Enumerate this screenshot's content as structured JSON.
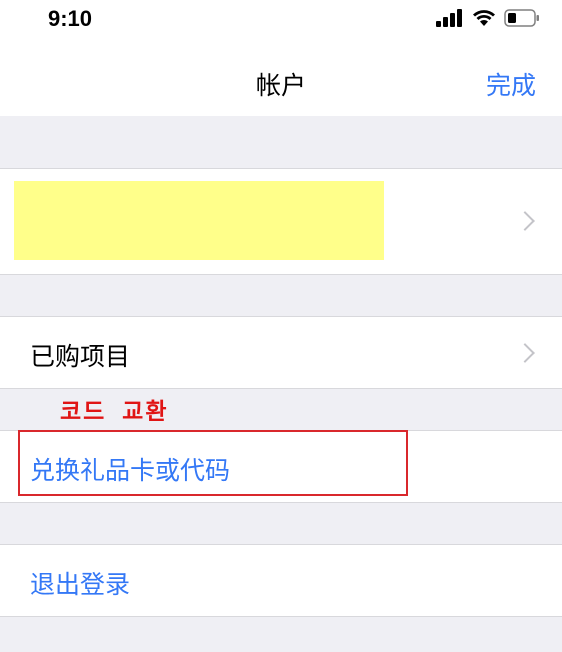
{
  "status_bar": {
    "time": "9:10",
    "icons": [
      "signal-icon",
      "wifi-icon",
      "battery-icon"
    ]
  },
  "nav": {
    "title": "帐户",
    "done_label": "完成"
  },
  "account": {
    "highlight_color": "#ffff8a"
  },
  "menu": {
    "purchased_label": "已购项目",
    "redeem_label": "兑换礼品卡或代码",
    "logout_label": "退出登录"
  },
  "annotation": {
    "text": "코드 교환",
    "color": "#e01414"
  },
  "colors": {
    "accent": "#3478f6",
    "background": "#efeff4",
    "highlight_box": "#d9282c"
  }
}
